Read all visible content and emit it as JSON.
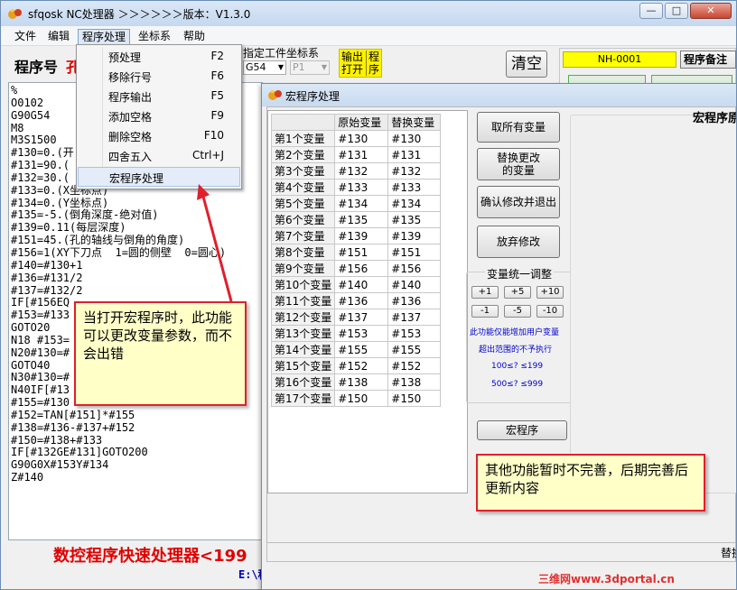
{
  "window": {
    "title": "sfqosk NC处理器 ＞＞＞＞＞＞版本：V1.3.0",
    "controls": {
      "minimize": "—",
      "maximize": "□",
      "close": "✕"
    }
  },
  "menu": {
    "file": "文件",
    "edit": "编辑",
    "program": "程序处理",
    "coord": "坐标系",
    "help": "帮助"
  },
  "dropdown": {
    "items": [
      {
        "label": "预处理",
        "shortcut": "F2"
      },
      {
        "label": "移除行号",
        "shortcut": "F6"
      },
      {
        "label": "程序输出",
        "shortcut": "F5"
      },
      {
        "label": "添加空格",
        "shortcut": "F9"
      },
      {
        "label": "删除空格",
        "shortcut": "F10"
      },
      {
        "label": "四舍五入",
        "shortcut": "Ctrl+J"
      },
      {
        "label": "宏程序处理",
        "shortcut": ""
      }
    ]
  },
  "toolbar": {
    "program_label": "程序号",
    "program_name": "孔",
    "coord_label": "指定工件坐标系",
    "coord_value": "G54",
    "p_value": "P1",
    "output_open_line1": "输出",
    "output_open_line2": "打开",
    "output_open_line3": "程",
    "output_open_line4": "序",
    "clear_label": "清空",
    "nh_number": "NH-0001",
    "remark_label": "程序备注"
  },
  "code_lines": [
    "%",
    "O0102",
    "G90G54",
    "M8",
    "M3S1500",
    "#130=0.(开",
    "#131=90.(",
    "#132=30.(",
    "#133=0.(X坐标点)",
    "#134=0.(Y坐标点)",
    "#135=-5.(倒角深度-绝对值)",
    "#139=0.11(每层深度)",
    "#151=45.(孔的轴线与倒角的角度)",
    "#156=1(XY下刀点  1=圆的侧壁  0=圆心)",
    "#140=#130+1",
    "#136=#131/2",
    "#137=#132/2",
    "IF[#156EQ",
    "#153=#133",
    "GOTO20",
    "N18 #153=",
    "N20#130=#",
    "GOTO40",
    "N30#130=#",
    "N40IF[#13",
    "#155=#130",
    "#152=TAN[#151]*#155",
    "#138=#136-#137+#152",
    "#150=#138+#133",
    "IF[#132GE#131]GOTO200",
    "G90G0X#153Y#134",
    "Z#140"
  ],
  "footer": {
    "banner": "数控程序快速处理器<199",
    "path": "E:\\程序\\HCX\\"
  },
  "dialog": {
    "title": "宏程序处理",
    "table": {
      "headers": [
        "",
        "原始变量",
        "替换变量"
      ],
      "rows": [
        [
          "第1个变量",
          "#130",
          "#130"
        ],
        [
          "第2个变量",
          "#131",
          "#131"
        ],
        [
          "第3个变量",
          "#132",
          "#132"
        ],
        [
          "第4个变量",
          "#133",
          "#133"
        ],
        [
          "第5个变量",
          "#134",
          "#134"
        ],
        [
          "第6个变量",
          "#135",
          "#135"
        ],
        [
          "第7个变量",
          "#139",
          "#139"
        ],
        [
          "第8个变量",
          "#151",
          "#151"
        ],
        [
          "第9个变量",
          "#156",
          "#156"
        ],
        [
          "第10个变量",
          "#140",
          "#140"
        ],
        [
          "第11个变量",
          "#136",
          "#136"
        ],
        [
          "第12个变量",
          "#137",
          "#137"
        ],
        [
          "第13个变量",
          "#153",
          "#153"
        ],
        [
          "第14个变量",
          "#155",
          "#155"
        ],
        [
          "第15个变量",
          "#152",
          "#152"
        ],
        [
          "第16个变量",
          "#138",
          "#138"
        ],
        [
          "第17个变量",
          "#150",
          "#150"
        ]
      ]
    },
    "buttons": {
      "fetch_all": "取所有变量",
      "replace_line1": "替换更改",
      "replace_line2": "的变量",
      "confirm_exit": "确认修改并退出",
      "discard": "放弃修改",
      "macro": "宏程序"
    },
    "adjust": {
      "title": "变量统一调整",
      "plus1": "+1",
      "plus5": "+5",
      "plus10": "+10",
      "minus1": "-1",
      "minus5": "-5",
      "minus10": "-10",
      "note1": "此功能仅能增加用户变量",
      "note2": "超出范围的不予执行",
      "note3": "100≤? ≤199",
      "note4": "500≤? ≤999"
    },
    "right_header": "宏程序原",
    "status_text": "替换"
  },
  "callouts": {
    "left": "当打开宏程序时，此功能可以更改变量参数，而不会出错",
    "right": "其他功能暂时不完善，后期完善后更新内容"
  },
  "watermark": "三维网www.3dportal.cn",
  "colors": {
    "accent_red": "#e00000",
    "highlight_yellow": "#fff200",
    "callout_bg": "#ffffc8",
    "note_blue": "#0000cc"
  }
}
